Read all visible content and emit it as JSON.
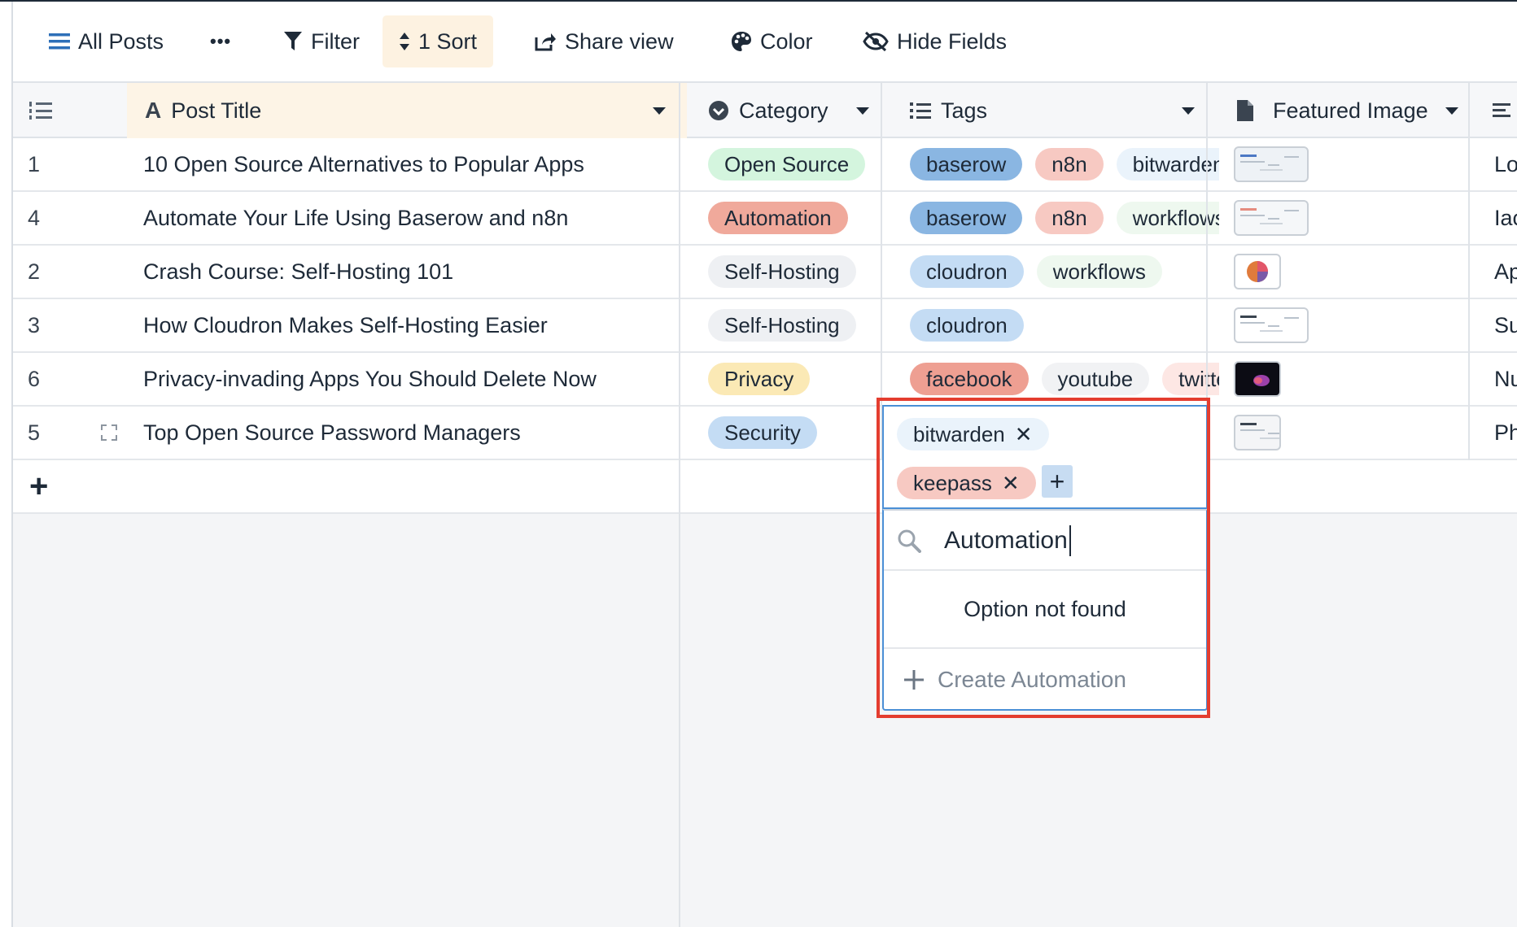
{
  "toolbar": {
    "view_name": "All Posts",
    "more": "•••",
    "filter": "Filter",
    "sort": "1 Sort",
    "share_view": "Share view",
    "color": "Color",
    "hide_fields": "Hide Fields"
  },
  "columns": {
    "post_title": "Post Title",
    "category": "Category",
    "tags": "Tags",
    "featured_image": "Featured Image"
  },
  "rows": [
    {
      "id": "1",
      "title": "10 Open Source Alternatives to Popular Apps",
      "category": "Open Source",
      "tags": [
        "baserow",
        "n8n",
        "bitwarden"
      ],
      "next": "Lor"
    },
    {
      "id": "4",
      "title": "Automate Your Life Using Baserow and n8n",
      "category": "Automation",
      "tags": [
        "baserow",
        "n8n",
        "workflows"
      ],
      "next": "Iacu"
    },
    {
      "id": "2",
      "title": "Crash Course: Self-Hosting 101",
      "category": "Self-Hosting",
      "tags": [
        "cloudron",
        "workflows"
      ],
      "next": "Apt"
    },
    {
      "id": "3",
      "title": "How Cloudron Makes Self-Hosting Easier",
      "category": "Self-Hosting",
      "tags": [
        "cloudron"
      ],
      "next": "Sus"
    },
    {
      "id": "6",
      "title": "Privacy-invading Apps You Should Delete Now",
      "category": "Privacy",
      "tags": [
        "facebook",
        "youtube",
        "twitte"
      ],
      "next": "Nu"
    },
    {
      "id": "5",
      "title": "Top Open Source Password Managers",
      "category": "Security",
      "tags": [
        "bitwarden",
        "keepass"
      ],
      "next": "Pha"
    }
  ],
  "editor": {
    "tags": [
      "bitwarden",
      "keepass"
    ],
    "remove_glyph": "✕",
    "add_glyph": "+"
  },
  "dropdown": {
    "search_value": "Automation",
    "empty_message": "Option not found",
    "create_label": "Create Automation"
  },
  "add_row_glyph": "+",
  "colors": {
    "open_source": "#d4f5de",
    "automation": "#f0a99b",
    "self_hosting": "#eef0f3",
    "privacy": "#fbe9b5",
    "security": "#c4dcf4",
    "baserow": "#8ab6e2",
    "n8n": "#f7c9c2",
    "bitwarden": "#eaf3fb",
    "workflows": "#eef8ef",
    "cloudron": "#c4dcf4",
    "facebook": "#ee9f92",
    "youtube": "#f1f2f4",
    "twitter": "#fde7e4",
    "keepass": "#f7c9c2",
    "highlight": "#e43d2f",
    "sort_active": "#fdf2e1"
  }
}
